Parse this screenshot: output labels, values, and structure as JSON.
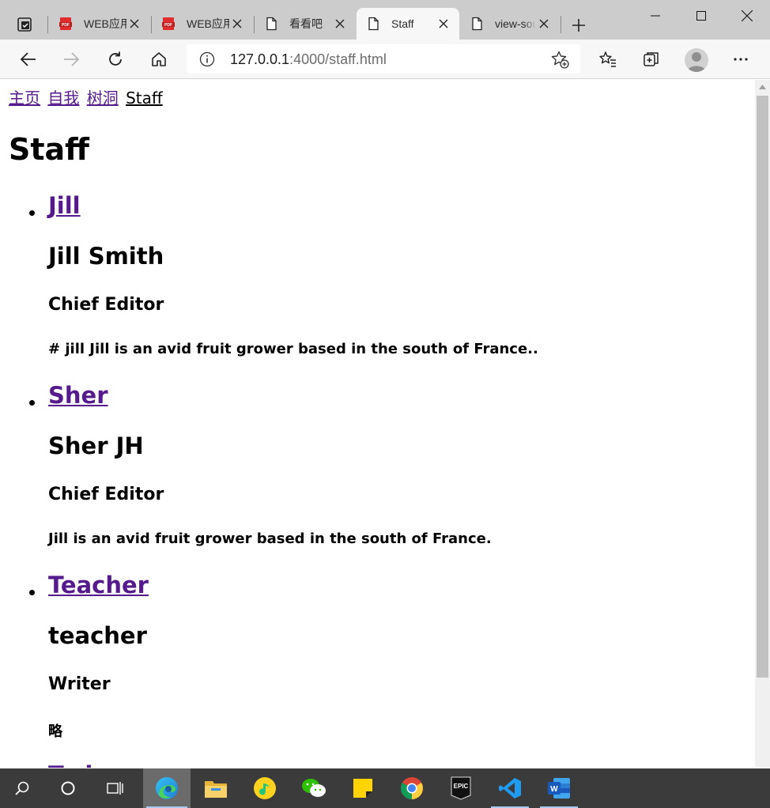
{
  "browser": {
    "tabs": [
      {
        "label": "WEB应用",
        "icon": "pdf-icon"
      },
      {
        "label": "WEB应用",
        "icon": "pdf-icon"
      },
      {
        "label": "看看吧",
        "icon": "page-icon"
      },
      {
        "label": "Staff",
        "icon": "page-icon",
        "active": true
      },
      {
        "label": "view-source",
        "icon": "page-icon"
      }
    ],
    "address": {
      "host": "127.0.0.1",
      "path": ":4000/staff.html"
    }
  },
  "page": {
    "nav": [
      {
        "label": "主页",
        "visited": true
      },
      {
        "label": "自我",
        "visited": true
      },
      {
        "label": "树洞",
        "visited": true
      },
      {
        "label": "Staff",
        "current": true
      }
    ],
    "title": "Staff",
    "staff": [
      {
        "link": "Jill",
        "name": "Jill Smith",
        "role": "Chief Editor",
        "bio": "# jill Jill is an avid fruit grower based in the south of France.."
      },
      {
        "link": "Sher",
        "name": "Sher JH",
        "role": "Chief Editor",
        "bio": "Jill is an avid fruit grower based in the south of France."
      },
      {
        "link": "Teacher",
        "name": "teacher",
        "role": "Writer",
        "bio": "略"
      },
      {
        "link": "Ted"
      }
    ]
  },
  "colors": {
    "visited_link": "#551a8b",
    "tabstrip": "#cccccc",
    "toolbar": "#f7f7f7",
    "taskbar": "#3b3b3b"
  },
  "taskbar": {
    "items": [
      "search-icon",
      "cortana-icon",
      "task-view-icon",
      "edge-icon",
      "file-explorer-icon",
      "qq-music-icon",
      "wechat-icon",
      "sticky-notes-icon",
      "chrome-icon",
      "epic-games-icon",
      "vscode-icon",
      "word-icon"
    ],
    "epic_label": "EPIC",
    "word_label": "W"
  }
}
